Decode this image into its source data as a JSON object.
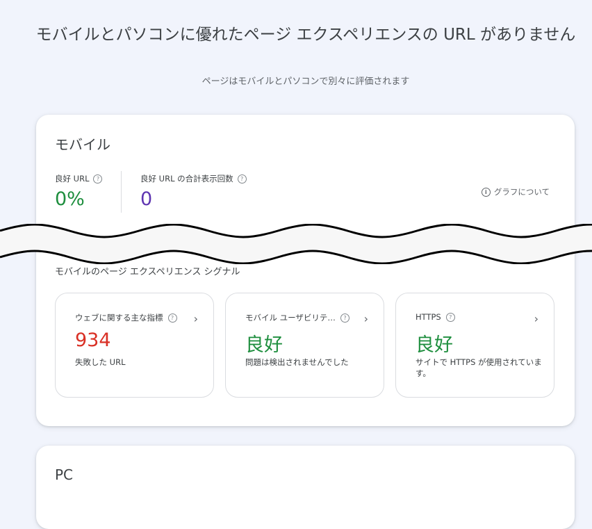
{
  "header": {
    "title": "モバイルとパソコンに優れたページ エクスペリエンスの URL がありません",
    "subtitle": "ページはモバイルとパソコンで別々に評価されます"
  },
  "mobile": {
    "title": "モバイル",
    "metrics": [
      {
        "label": "良好 URL",
        "value": "0%",
        "color": "#1e8e3e"
      },
      {
        "label": "良好 URL の合計表示回数",
        "value": "0",
        "color": "#5e35b1"
      }
    ],
    "graph_link": "グラフについて",
    "signals_title": "モバイルのページ エクスペリエンス シグナル",
    "signals": [
      {
        "label": "ウェブに関する主な指標",
        "value": "934",
        "desc": "失敗した URL",
        "icon": "help-icon"
      },
      {
        "label": "モバイル ユーザビリテ…",
        "value": "良好",
        "desc": "問題は検出されませんでした",
        "icon": "help-icon"
      },
      {
        "label": "HTTPS",
        "value": "良好",
        "desc": "サイトで HTTPS が使用されています。",
        "icon": "help-icon"
      }
    ]
  },
  "pc": {
    "title": "PC"
  },
  "colors": {
    "good": "#1e8e3e",
    "poor": "#d93025",
    "impressions": "#5e35b1"
  }
}
